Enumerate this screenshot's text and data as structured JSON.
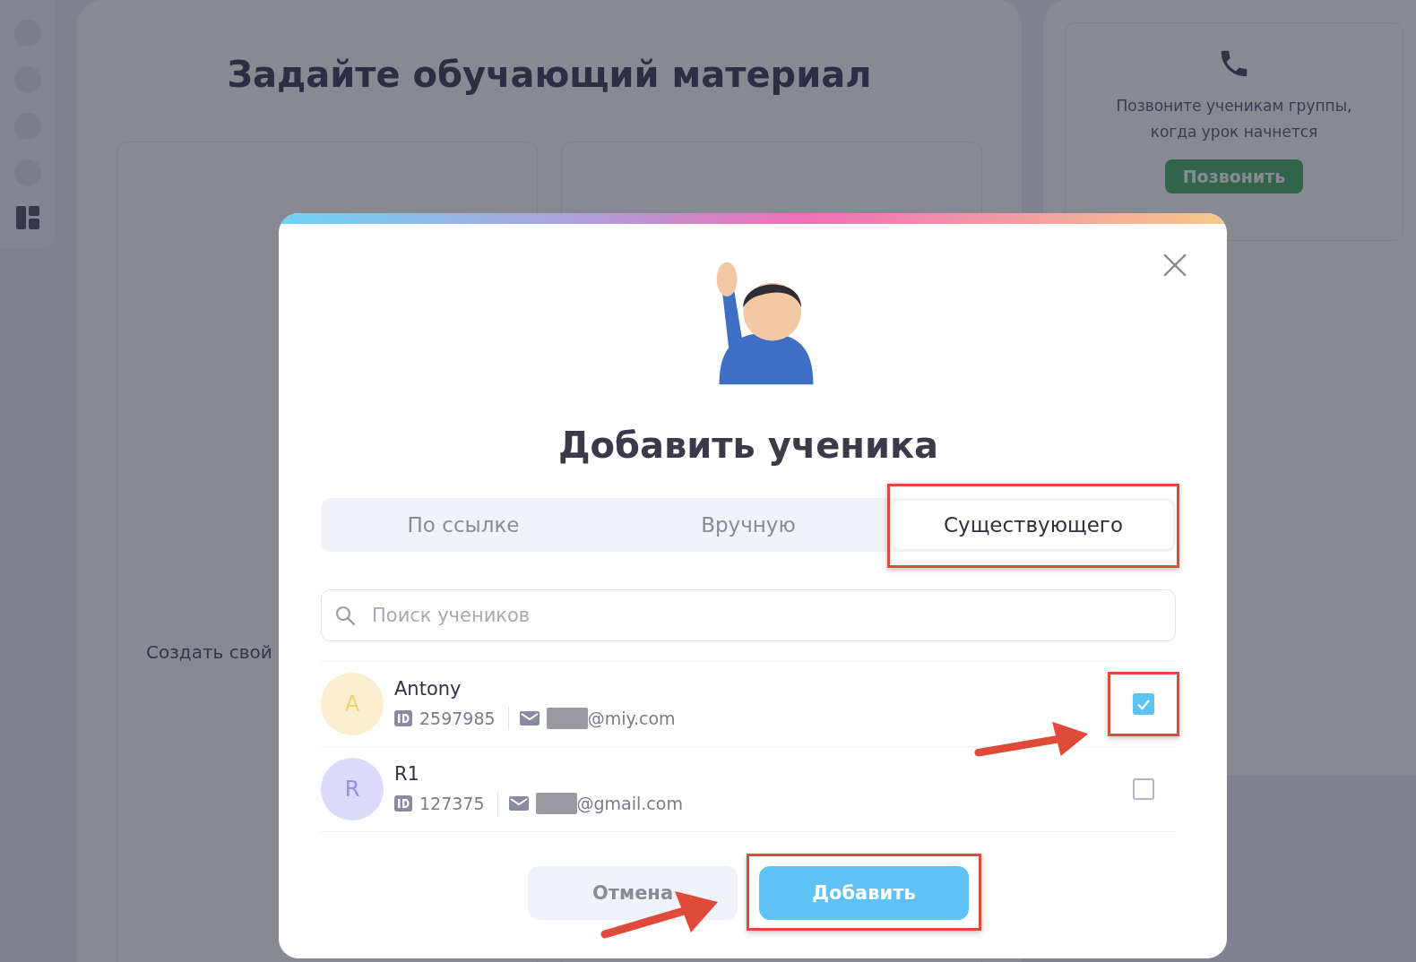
{
  "page": {
    "title": "Задайте обучающий материал",
    "create_label": "Создать свой",
    "call_card": {
      "text_lines": [
        "Позвоните ученикам группы,",
        "когда урок начнется"
      ],
      "button": "Позвонить"
    }
  },
  "dialog": {
    "title": "Добавить ученика",
    "tabs": [
      {
        "label": "По ссылке",
        "selected": false,
        "highlighted": false
      },
      {
        "label": "Вручную",
        "selected": false,
        "highlighted": false
      },
      {
        "label": "Существующего",
        "selected": true,
        "highlighted": true
      }
    ],
    "search": {
      "placeholder": "Поиск учеников"
    },
    "students": [
      {
        "initial": "A",
        "name": "Antony",
        "id": "2597985",
        "email_domain": "@miy.com",
        "checked": true,
        "highlighted": true,
        "color": "#f2cf6e"
      },
      {
        "initial": "R",
        "name": "R1",
        "id": "127375",
        "email_domain": "@gmail.com",
        "checked": false,
        "highlighted": false,
        "color": "#8f8ff0"
      }
    ],
    "buttons": [
      {
        "kind": "secondary",
        "label": "Отмена",
        "highlighted": false
      },
      {
        "kind": "primary",
        "label": "Добавить",
        "highlighted": true
      }
    ]
  }
}
